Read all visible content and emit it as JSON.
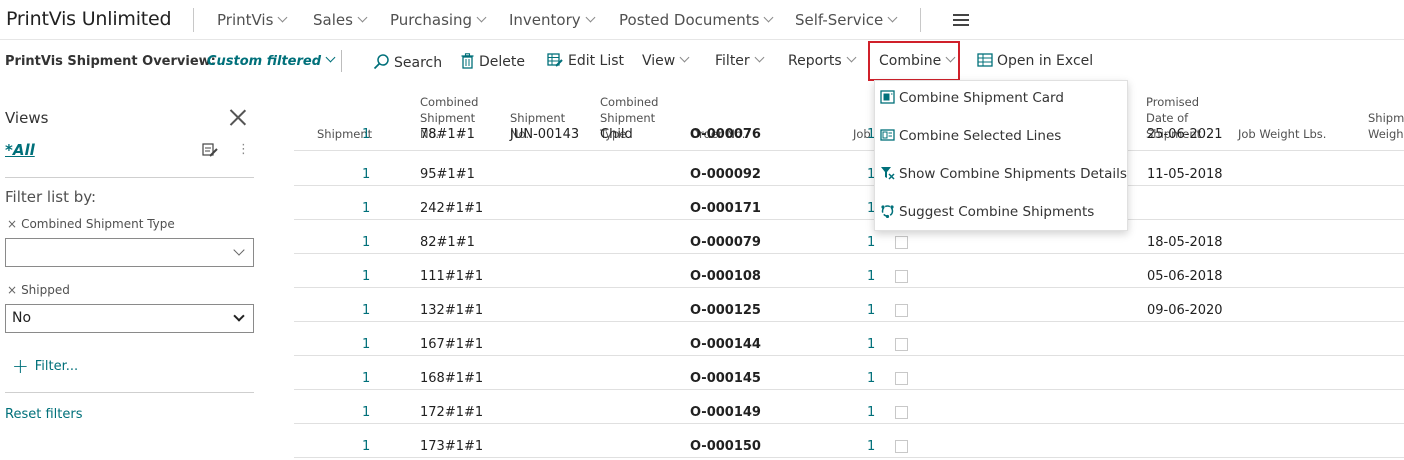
{
  "app_title": "PrintVis Unlimited",
  "nav": {
    "items": [
      {
        "label": "PrintVis"
      },
      {
        "label": "Sales"
      },
      {
        "label": "Purchasing"
      },
      {
        "label": "Inventory"
      },
      {
        "label": "Posted Documents"
      },
      {
        "label": "Self-Service"
      }
    ]
  },
  "actionbar": {
    "page_caption": "PrintVis Shipment Overview:",
    "filter_state": "Custom filtered",
    "actions": {
      "search": "Search",
      "delete": "Delete",
      "edit_list": "Edit List",
      "view": "View",
      "filter": "Filter",
      "reports": "Reports",
      "combine": "Combine",
      "open_excel": "Open in Excel"
    }
  },
  "filter_pane": {
    "views_title": "Views",
    "all_view": "*All",
    "filter_by_label": "Filter list by:",
    "fields": [
      {
        "label": "Combined Shipment Type",
        "value": ""
      },
      {
        "label": "Shipped",
        "value": "No"
      }
    ],
    "add_filter": "Filter...",
    "reset_filters": "Reset filters"
  },
  "grid": {
    "columns": {
      "shipment": "Shipment",
      "combined_no": [
        "Combined",
        "Shipment",
        "No."
      ],
      "shipment_no": [
        "Shipment",
        "No."
      ],
      "combined_type": [
        "Combined",
        "Shipment",
        "Type"
      ],
      "order_no": "Order No.",
      "job": "Job",
      "promised_date": [
        "Promised",
        "Date of",
        "Shipment"
      ],
      "job_weight": "Job Weight Lbs.",
      "ship_weight": [
        "Shipm",
        "Weigh"
      ]
    },
    "rows": [
      {
        "shipment": "1",
        "combined_no": "78#1#1",
        "shipment_no": "JUN-00143",
        "combined_type": "Child",
        "order_no": "O-000076",
        "job": "1",
        "promised_date": "25-06-2021"
      },
      {
        "shipment": "1",
        "combined_no": "95#1#1",
        "shipment_no": "",
        "combined_type": "",
        "order_no": "O-000092",
        "job": "1",
        "promised_date": "11-05-2018"
      },
      {
        "shipment": "1",
        "combined_no": "242#1#1",
        "shipment_no": "",
        "combined_type": "",
        "order_no": "O-000171",
        "job": "1",
        "promised_date": ""
      },
      {
        "shipment": "1",
        "combined_no": "82#1#1",
        "shipment_no": "",
        "combined_type": "",
        "order_no": "O-000079",
        "job": "1",
        "promised_date": "18-05-2018"
      },
      {
        "shipment": "1",
        "combined_no": "111#1#1",
        "shipment_no": "",
        "combined_type": "",
        "order_no": "O-000108",
        "job": "1",
        "promised_date": "05-06-2018"
      },
      {
        "shipment": "1",
        "combined_no": "132#1#1",
        "shipment_no": "",
        "combined_type": "",
        "order_no": "O-000125",
        "job": "1",
        "promised_date": "09-06-2020"
      },
      {
        "shipment": "1",
        "combined_no": "167#1#1",
        "shipment_no": "",
        "combined_type": "",
        "order_no": "O-000144",
        "job": "1",
        "promised_date": ""
      },
      {
        "shipment": "1",
        "combined_no": "168#1#1",
        "shipment_no": "",
        "combined_type": "",
        "order_no": "O-000145",
        "job": "1",
        "promised_date": ""
      },
      {
        "shipment": "1",
        "combined_no": "172#1#1",
        "shipment_no": "",
        "combined_type": "",
        "order_no": "O-000149",
        "job": "1",
        "promised_date": ""
      },
      {
        "shipment": "1",
        "combined_no": "173#1#1",
        "shipment_no": "",
        "combined_type": "",
        "order_no": "O-000150",
        "job": "1",
        "promised_date": ""
      }
    ]
  },
  "combine_menu": {
    "items": [
      {
        "label": "Combine Shipment Card",
        "icon": "card-icon"
      },
      {
        "label": "Combine Selected Lines",
        "icon": "lines-icon"
      },
      {
        "label": "Show Combine Shipments Details",
        "icon": "filter-details-icon"
      },
      {
        "label": "Suggest Combine Shipments",
        "icon": "suggest-icon"
      }
    ]
  },
  "colors": {
    "accent": "#00707a",
    "highlight_border": "#d0202a"
  }
}
